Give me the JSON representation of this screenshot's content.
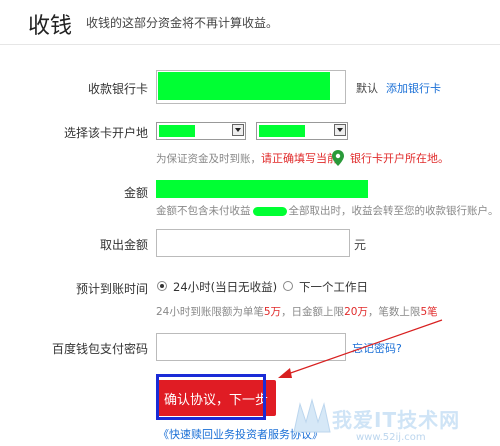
{
  "header": {
    "title": "收钱",
    "subtitle": "收钱的这部分资金将不再计算收益。"
  },
  "form": {
    "card_label": "收款银行卡",
    "default_tag": "默认",
    "add_card_link": "添加银行卡",
    "branch_label": "选择该卡开户地",
    "branch_hint_prefix": "为保证资金及时到账，",
    "branch_hint_warning": "请正确填写当前",
    "branch_hint_warning_end": "银行卡开户所在地。",
    "amount_label": "金额",
    "amount_hint_prefix": "金额不包含未付收益",
    "amount_hint_suffix": "全部取出时，收益会转至您的收款银行账户。",
    "withdraw_label": "取出金额",
    "withdraw_unit": "元",
    "eta_label": "预计到账时间",
    "eta_option1": "24小时(当日无收益)",
    "eta_option2": "下一个工作日",
    "limit_hint_1": "24小时到账限额为单笔",
    "limit_value_1": "5万",
    "limit_hint_2": "，日金额上限",
    "limit_value_2": "20万",
    "limit_hint_3": "，笔数上限",
    "limit_value_3": "5笔",
    "password_label": "百度钱包支付密码",
    "forgot_link": "忘记密码?",
    "confirm_button": "确认协议，下一步",
    "agreement_link": "《快速赎回业务投资者服务协议》"
  },
  "watermark": {
    "text": "我爱IT技术网",
    "url": "www.52ij.com"
  },
  "colors": {
    "accent_red": "#e01c24",
    "link_blue": "#1a6fd6",
    "frame_blue": "#1a2bd6",
    "redaction_green": "#00ff33"
  }
}
